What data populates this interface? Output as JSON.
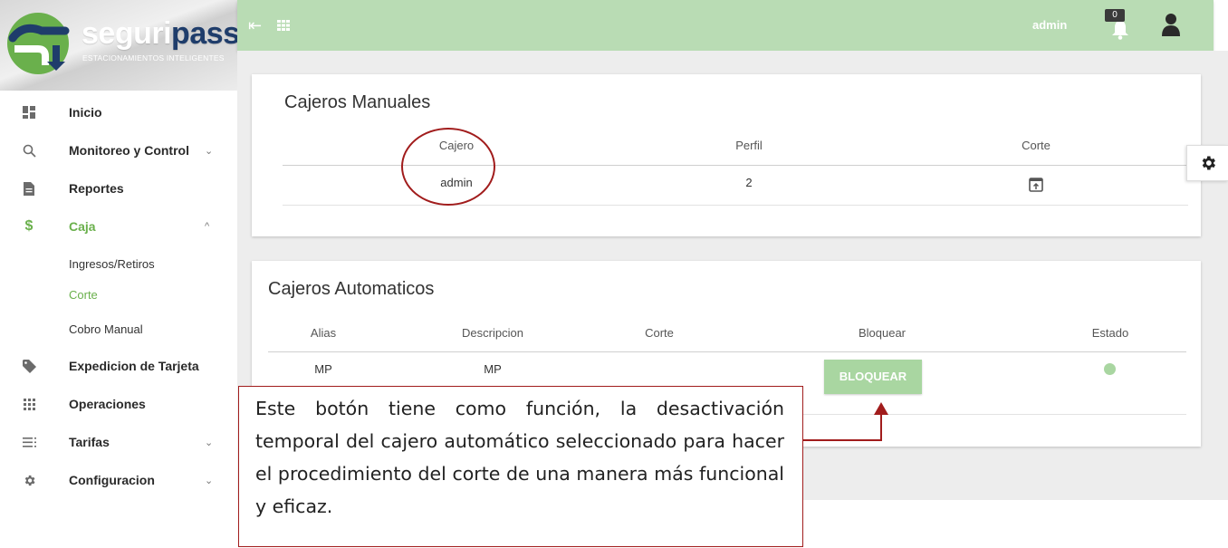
{
  "brand": {
    "name_part1": "seguri",
    "name_part2": "pass",
    "tagline": "ESTACIONAMIENTOS INTELIGENTES"
  },
  "sidebar": {
    "items": [
      {
        "label": "Inicio",
        "icon": "dashboard-icon"
      },
      {
        "label": "Monitoreo y Control",
        "icon": "search-icon",
        "chevron": "chevron-down-icon"
      },
      {
        "label": "Reportes",
        "icon": "document-icon"
      },
      {
        "label": "Caja",
        "icon": "dollar-icon",
        "chevron": "chevron-up-icon",
        "active": true
      },
      {
        "label": "Expedicion de Tarjeta",
        "icon": "tag-icon"
      },
      {
        "label": "Operaciones",
        "icon": "apps-grid-icon"
      },
      {
        "label": "Tarifas",
        "icon": "list-icon",
        "chevron": "chevron-down-icon"
      },
      {
        "label": "Configuracion",
        "icon": "gear-icon",
        "chevron": "chevron-down-icon"
      }
    ],
    "caja_subitems": [
      {
        "label": "Ingresos/Retiros"
      },
      {
        "label": "Corte",
        "active": true
      },
      {
        "label": "Cobro Manual"
      }
    ],
    "chevron_down": "⌄",
    "chevron_up": "^"
  },
  "topbar": {
    "user": "admin",
    "notification_count": "0"
  },
  "manual": {
    "title": "Cajeros Manuales",
    "headers": [
      "Cajero",
      "Perfil",
      "Corte"
    ],
    "rows": [
      {
        "cajero": "admin",
        "perfil": "2",
        "corte_icon": "open-in-new-icon"
      }
    ]
  },
  "auto": {
    "title": "Cajeros Automaticos",
    "headers": [
      "Alias",
      "Descripcion",
      "Corte",
      "Bloquear",
      "Estado"
    ],
    "rows": [
      {
        "alias": "MP",
        "descripcion": "MP",
        "corte": "",
        "button": "BLOQUEAR",
        "estado": "active"
      }
    ]
  },
  "annotation": {
    "text": "Este botón tiene como función, la desactivación temporal del cajero automático seleccionado para hacer el procedimiento del corte de una manera más funcional y eficaz."
  },
  "colors": {
    "accent_green": "#6ab04c",
    "topbar": "#b9dcb4",
    "button": "#a9d6a1",
    "annotation_red": "#a11c1c"
  }
}
